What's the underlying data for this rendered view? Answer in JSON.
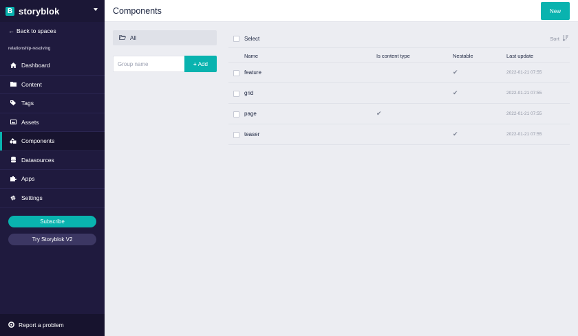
{
  "brand": {
    "name": "storyblok",
    "logo_letter": "B"
  },
  "sidebar": {
    "back_label": "Back to spaces",
    "space_name": "relationship-resolving",
    "items": [
      {
        "label": "Dashboard",
        "icon": "home-icon"
      },
      {
        "label": "Content",
        "icon": "folder-icon"
      },
      {
        "label": "Tags",
        "icon": "tags-icon"
      },
      {
        "label": "Assets",
        "icon": "image-icon"
      },
      {
        "label": "Components",
        "icon": "components-icon",
        "active": true
      },
      {
        "label": "Datasources",
        "icon": "database-icon"
      },
      {
        "label": "Apps",
        "icon": "puzzle-icon"
      },
      {
        "label": "Settings",
        "icon": "gear-icon"
      }
    ],
    "subscribe_label": "Subscribe",
    "try_v2_label": "Try Storyblok V2",
    "report_label": "Report a problem"
  },
  "header": {
    "title": "Components",
    "new_label": "New"
  },
  "groups": {
    "all_label": "All",
    "input_placeholder": "Group name",
    "input_value": "",
    "add_label": "Add"
  },
  "table": {
    "select_label": "Select",
    "sort_label": "Sort",
    "columns": [
      "Name",
      "Is content type",
      "Nestable",
      "Last update"
    ],
    "rows": [
      {
        "name": "feature",
        "content_type": false,
        "nestable": true,
        "updated": "2022-01-21 07:55"
      },
      {
        "name": "grid",
        "content_type": false,
        "nestable": true,
        "updated": "2022-01-21 07:55"
      },
      {
        "name": "page",
        "content_type": true,
        "nestable": false,
        "updated": "2022-01-21 07:55"
      },
      {
        "name": "teaser",
        "content_type": false,
        "nestable": true,
        "updated": "2022-01-21 07:55"
      }
    ]
  },
  "colors": {
    "accent": "#09b3af",
    "sidebar": "#1f1a3e",
    "background": "#ecedf2"
  }
}
